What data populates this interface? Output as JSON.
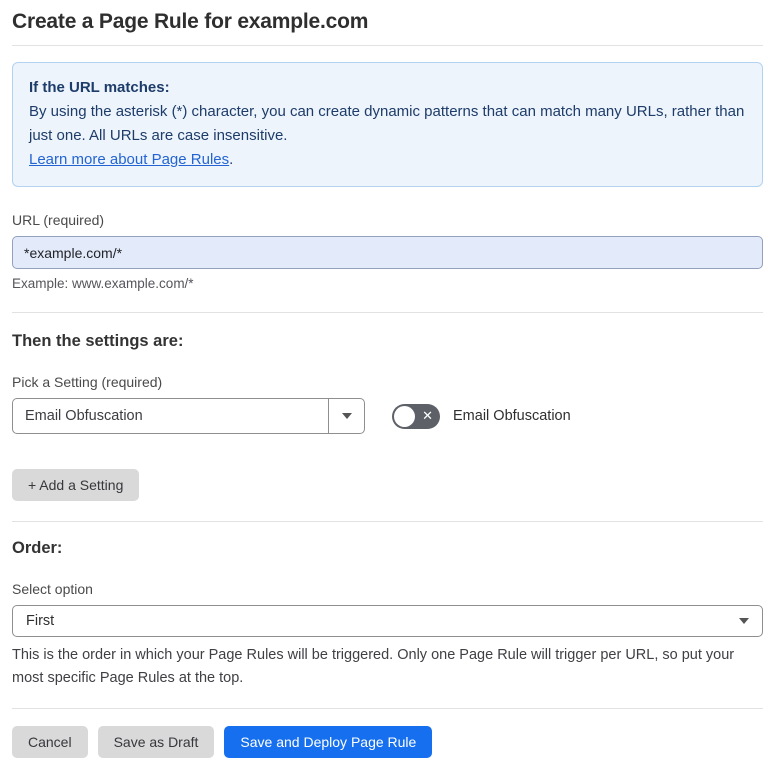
{
  "page": {
    "title": "Create a Page Rule for example.com"
  },
  "info_box": {
    "heading": "If the URL matches:",
    "body": "By using the asterisk (*) character, you can create dynamic patterns that can match many URLs, rather than just one. All URLs are case insensitive.",
    "link_label": "Learn more about Page Rules",
    "link_suffix": "."
  },
  "url_section": {
    "label": "URL (required)",
    "value": "*example.com/*",
    "example": "Example: www.example.com/*"
  },
  "settings_section": {
    "heading": "Then the settings are:",
    "picker_label": "Pick a Setting (required)",
    "picker_value": "Email Obfuscation",
    "picker_arrow_icon": "caret-down",
    "toggle_label": "Email Obfuscation",
    "toggle_state": "off",
    "toggle_glyph": "✕",
    "add_setting_label": "+ Add a Setting"
  },
  "order_section": {
    "heading": "Order:",
    "select_label": "Select option",
    "select_value": "First",
    "help": "This is the order in which your Page Rules will be triggered. Only one Page Rule will trigger per URL, so put your most specific Page Rules at the top."
  },
  "footer": {
    "cancel_label": "Cancel",
    "save_draft_label": "Save as Draft",
    "save_deploy_label": "Save and Deploy Page Rule"
  },
  "colors": {
    "accent_blue": "#166fee",
    "info_bg": "#edf4fc",
    "info_border": "#b3d2ef",
    "info_text": "#1e3c69",
    "link_blue": "#2464d2",
    "input_bg": "#e3ebfa",
    "toggle_off_bg": "#5d6167",
    "button_gray": "#d9d9d9"
  }
}
